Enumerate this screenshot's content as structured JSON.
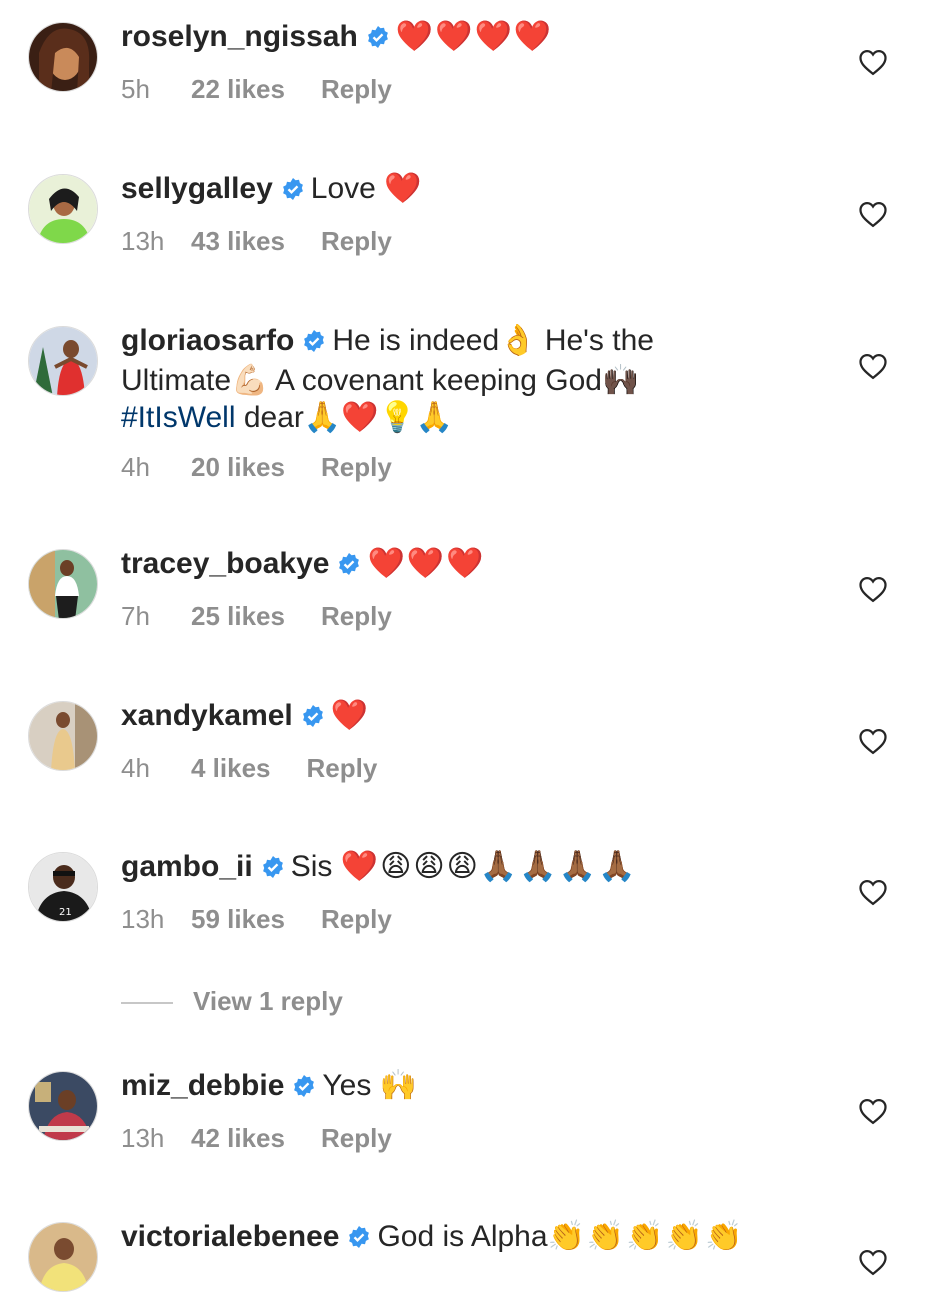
{
  "comments": [
    {
      "username": "roselyn_ngissah",
      "text": "",
      "emojis": "❤️❤️❤️❤️",
      "time": "5h",
      "likes": "22 likes",
      "reply": "Reply",
      "avatar_colors": [
        "#3a1f14",
        "#c98a5a"
      ]
    },
    {
      "username": "sellygalley",
      "text": "Love ",
      "emojis": "❤️",
      "time": "13h",
      "likes": "43 likes",
      "reply": "Reply",
      "avatar_colors": [
        "#e9f1d8",
        "#7fd84a"
      ]
    },
    {
      "username": "gloriaosarfo",
      "line1": "He is indeed👌 He's the",
      "line2": "Ultimate💪🏻 A covenant keeping God🙌🏿",
      "hashtag": "#ItIsWell",
      "line3_rest": " dear🙏❤️💡🙏",
      "time": "4h",
      "likes": "20 likes",
      "reply": "Reply",
      "avatar_colors": [
        "#cfd8e6",
        "#e0302f"
      ]
    },
    {
      "username": "tracey_boakye",
      "text": "",
      "emojis": "❤️❤️❤️",
      "time": "7h",
      "likes": "25 likes",
      "reply": "Reply",
      "avatar_colors": [
        "#8fc0a0",
        "#1d1d1d"
      ]
    },
    {
      "username": "xandykamel",
      "text": "",
      "emojis": "❤️",
      "time": "4h",
      "likes": "4 likes",
      "reply": "Reply",
      "avatar_colors": [
        "#d8cfc2",
        "#e9c98d"
      ]
    },
    {
      "username": "gambo_ii",
      "text": "Sis ",
      "emojis": "❤️😩😩😩🙏🏾🙏🏾🙏🏾🙏🏾",
      "time": "13h",
      "likes": "59 likes",
      "reply": "Reply",
      "avatar_colors": [
        "#e8e8e8",
        "#1a1a1a"
      ]
    },
    {
      "username": "miz_debbie",
      "text": "Yes ",
      "emojis": "🙌",
      "time": "13h",
      "likes": "42 likes",
      "reply": "Reply",
      "avatar_colors": [
        "#3b4a63",
        "#c03a4a"
      ]
    },
    {
      "username": "victorialebenee",
      "text": "God is Alpha",
      "emojis": "👏👏👏👏👏",
      "avatar_colors": [
        "#d9b98a",
        "#f2e27a"
      ]
    }
  ],
  "view_replies": "View 1 reply",
  "colors": {
    "verified": "#3897f0",
    "link": "#00376b",
    "muted": "#8e8e8e",
    "text": "#262626"
  },
  "icons": {
    "verified": "verified-badge-icon",
    "like": "heart-outline-icon"
  }
}
